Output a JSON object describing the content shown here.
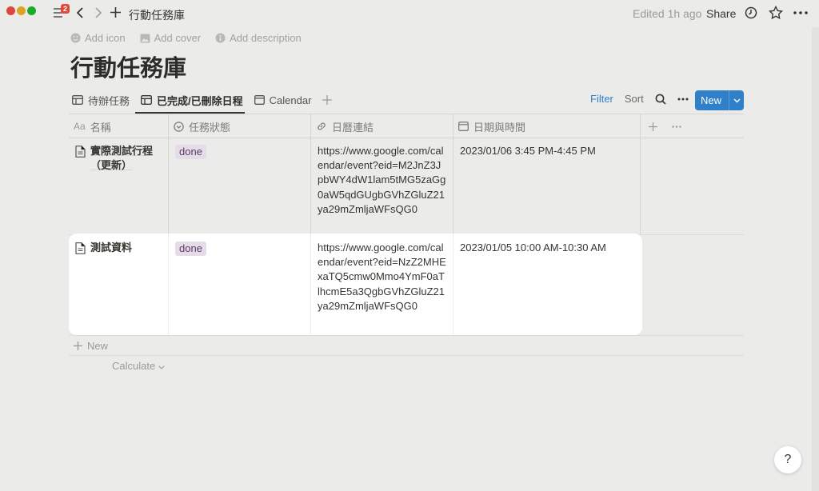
{
  "topbar": {
    "badge_count": "2",
    "breadcrumb": "行動任務庫",
    "edited": "Edited 1h ago",
    "share_label": "Share",
    "icons": [
      "sidebar-toggle-icon",
      "back-arrow-icon",
      "forward-arrow-icon",
      "plus-icon",
      "clock-icon",
      "star-icon",
      "more-icon"
    ]
  },
  "page": {
    "add_icon": "Add icon",
    "add_cover": "Add cover",
    "add_description": "Add description",
    "title": "行動任務庫"
  },
  "views": {
    "tabs": [
      {
        "label": "待辦任務",
        "icon": "table-icon"
      },
      {
        "label": "已完成/已刪除日程",
        "icon": "table-icon",
        "active": true
      },
      {
        "label": "Calendar",
        "icon": "calendar-icon"
      }
    ],
    "filter_label": "Filter",
    "sort_label": "Sort",
    "new_label": "New"
  },
  "table": {
    "columns": [
      {
        "label": "名稱",
        "icon_text": "Aa"
      },
      {
        "label": "任務狀態",
        "icon": "status-icon"
      },
      {
        "label": "日曆連結",
        "icon": "link-icon"
      },
      {
        "label": "日期與時間",
        "icon": "calendar-icon"
      }
    ],
    "rows": [
      {
        "name": "實際測試行程（更新）",
        "status": "done",
        "link": "https://www.google.com/calendar/event?eid=M2JnZ3JpbWY4dW1lam5tMG5zaGg0aW5qdGUgbGVhZGluZ21ya29mZmljaWFsQG0",
        "datetime": "2023/01/06 3:45 PM-4:45 PM"
      },
      {
        "name": "測試資料",
        "status": "done",
        "link": "https://www.google.com/calendar/event?eid=NzZ2MHExaTQ5cmw0Mmo4YmF0aTlhcmE5a3QgbGVhZGluZ21ya29mZmljaWFsQG0",
        "datetime": "2023/01/05 10:00 AM-10:30 AM"
      }
    ],
    "new_row_label": "New",
    "calculate_label": "Calculate"
  },
  "help_label": "?",
  "colors": {
    "accent_blue": "#2f7fc9",
    "tag_done_bg": "#e6dbe8",
    "badge_red": "#e2493b"
  }
}
